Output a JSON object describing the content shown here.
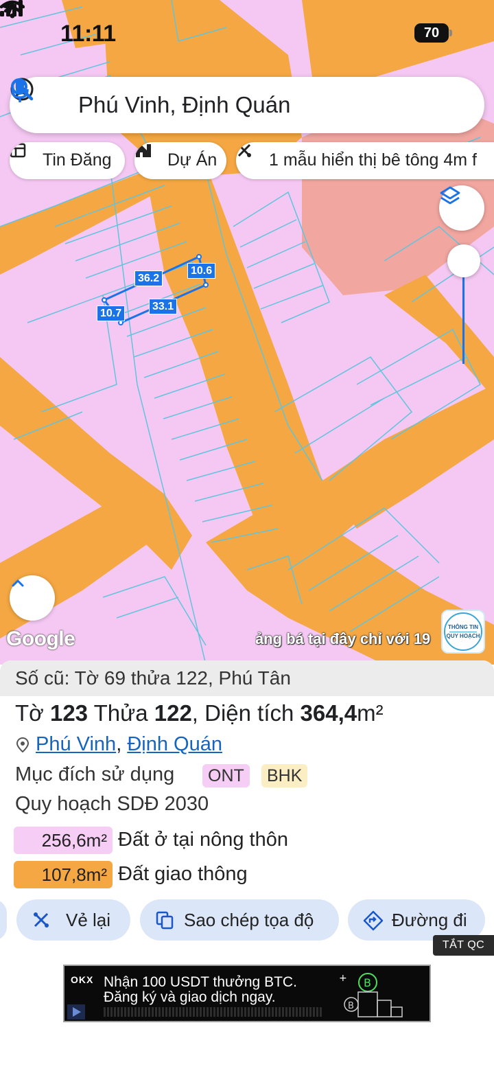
{
  "status": {
    "time": "11:11",
    "battery": "70"
  },
  "search": {
    "query": "Phú Vinh, Định Quán"
  },
  "chips": [
    {
      "label": "Tin Đăng",
      "icon": "listing-icon"
    },
    {
      "label": "Dự Án",
      "icon": "project-icon"
    },
    {
      "label": "1 mẫu hiển thị bê tông 4m f",
      "icon": "tools-icon"
    }
  ],
  "map": {
    "google": "Google",
    "marquee": "ảng bá tại đây chỉ với 19",
    "badge_line1": "THÔNG TIN",
    "badge_line2": "QUY HOẠCH",
    "dims": [
      "36.2",
      "10.6",
      "10.7",
      "33.1"
    ],
    "colors": {
      "residential": "#f4c8f2",
      "road": "#f4a742",
      "commercial": "#f2a6a0",
      "parcel_line": "#61c4dc",
      "measure": "#1a73e8"
    }
  },
  "panel": {
    "old_ref": "Số cũ: Tờ 69 thửa 122, Phú Tân",
    "title": {
      "prefix": "Tờ ",
      "sheet": "123",
      "mid": " Thửa ",
      "parcel": "122",
      "mid2": ", Diện tích ",
      "area": "364,4",
      "unit": "m²"
    },
    "location": {
      "commune": "Phú Vinh",
      "sep": ", ",
      "district": "Định Quán"
    },
    "purpose_label": "Mục đích sử dụng",
    "purpose_tags": [
      "ONT",
      "BHK"
    ],
    "plan_label": "Quy hoạch SDĐ 2030",
    "areas": [
      {
        "value": "256,6m²",
        "desc": "Đất ở tại nông thôn",
        "color": "#f6cdf4"
      },
      {
        "value": "107,8m²",
        "desc": "Đất giao thông",
        "color": "#f4a742"
      }
    ],
    "actions": [
      {
        "label": "Vẻ lại",
        "icon": "redraw-icon"
      },
      {
        "label": "Sao chép tọa độ",
        "icon": "copy-icon"
      },
      {
        "label": "Đường đi",
        "icon": "directions-icon"
      }
    ],
    "hide_ads": "TẮT QC"
  },
  "ad": {
    "brand": "OKX",
    "line1": "Nhận 100 USDT thưởng BTC.",
    "line2": "Đăng ký và giao dịch ngay."
  }
}
